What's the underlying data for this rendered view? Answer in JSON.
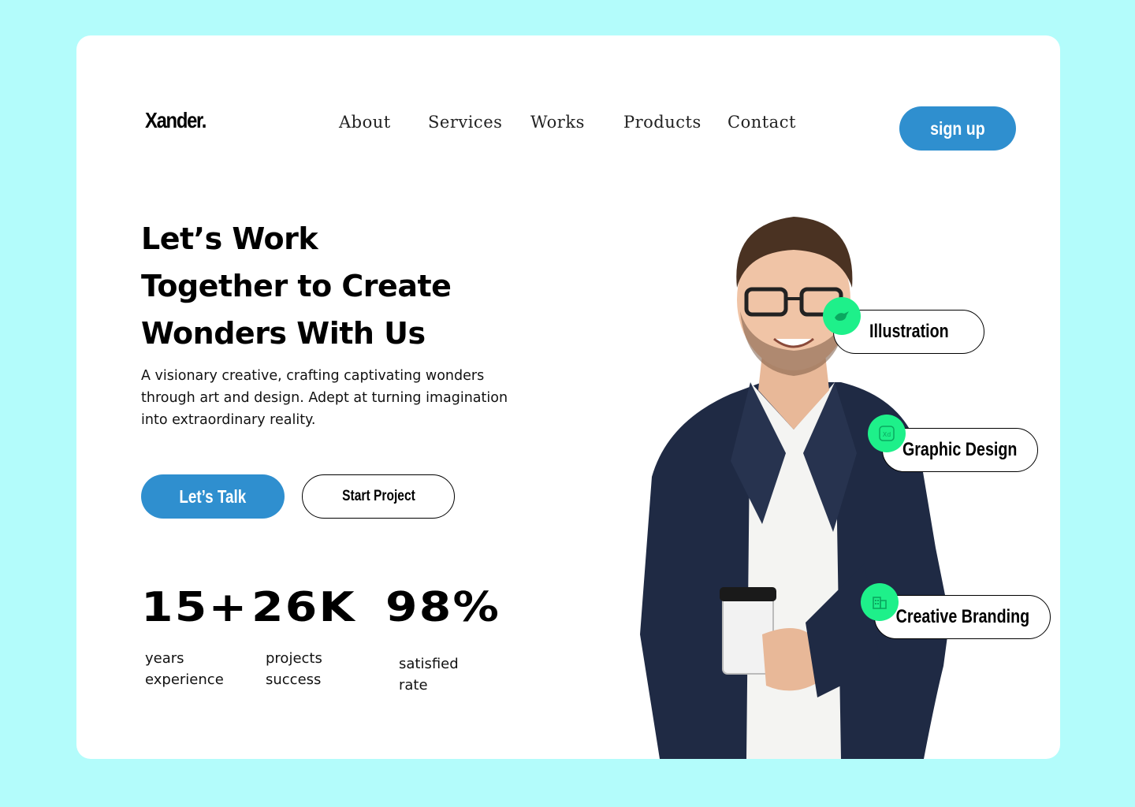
{
  "brand": {
    "logo": "Xander."
  },
  "nav": {
    "items": [
      "About",
      "Services",
      "Works",
      "Products",
      "Contact"
    ]
  },
  "header": {
    "signup_label": "sign up"
  },
  "hero": {
    "headline_lines": [
      "Let’s Work",
      "Together to Create",
      "Wonders With Us"
    ],
    "description": "A visionary creative, crafting captivating wonders through art and design. Adept at turning imagination into extraordinary reality.",
    "primary_button": "Let’s Talk",
    "secondary_button": "Start Project"
  },
  "stats": [
    {
      "value": "15+",
      "label_lines": [
        "years",
        "experience"
      ]
    },
    {
      "value": "26K",
      "label_lines": [
        "projects",
        "success"
      ]
    },
    {
      "value": "98%",
      "label_lines": [
        "satisfied",
        "rate"
      ]
    }
  ],
  "services": [
    {
      "label": "Illustration",
      "icon": "bird-icon"
    },
    {
      "label": "Graphic Design",
      "icon": "xd-icon"
    },
    {
      "label": "Creative Branding",
      "icon": "building-icon"
    }
  ],
  "colors": {
    "background": "#b3fcfb",
    "accent": "#2f8fcf",
    "badge": "#1ef08a"
  }
}
